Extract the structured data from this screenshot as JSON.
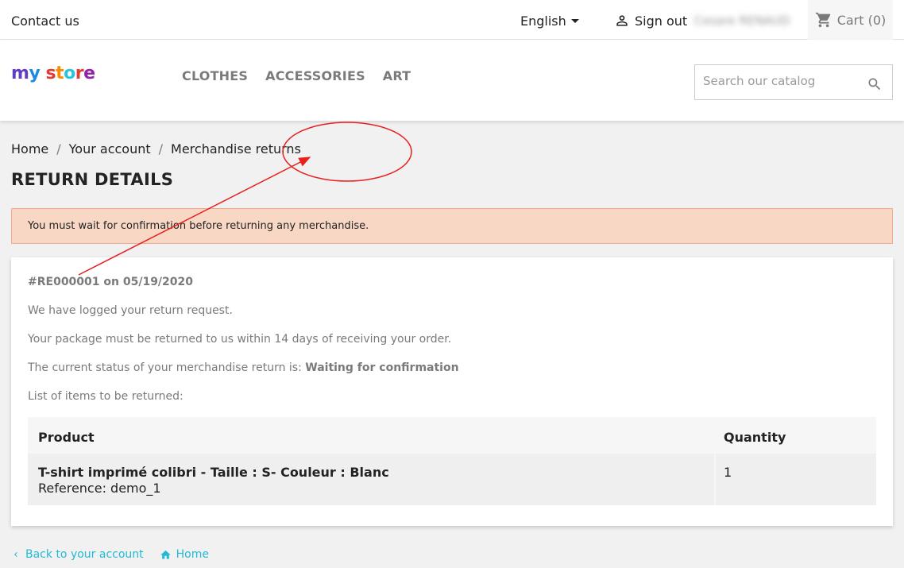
{
  "topbar": {
    "contact": "Contact us",
    "language": "English",
    "signout": "Sign out",
    "username": "Cesare RENAUD",
    "cart": "Cart (0)"
  },
  "header": {
    "logo": {
      "m": "m",
      "y": "y",
      "space": " ",
      "s": "s",
      "t": "t",
      "o": "o",
      "r": "r",
      "e": "e"
    },
    "menu": [
      "CLOTHES",
      "ACCESSORIES",
      "ART"
    ],
    "search_placeholder": "Search our catalog"
  },
  "breadcrumb": [
    "Home",
    "Your account",
    "Merchandise returns"
  ],
  "page_title": "RETURN DETAILS",
  "alert": "You must wait for confirmation before returning any merchandise.",
  "card": {
    "reference": "#RE000001 on 05/19/2020",
    "line1": "We have logged your return request.",
    "line2": "Your package must be returned to us within 14 days of receiving your order.",
    "status_prefix": "The current status of your merchandise return is: ",
    "status": "Waiting for confirmation",
    "line4": "List of items to be returned:",
    "table": {
      "headers": [
        "Product",
        "Quantity"
      ],
      "rows": [
        {
          "product": "T-shirt imprimé colibri - Taille : S- Couleur : Blanc",
          "reference": "Reference: demo_1",
          "quantity": "1"
        }
      ]
    }
  },
  "footer": {
    "back": "Back to your account",
    "home": "Home"
  },
  "colors": {
    "accent": "#24b9d7",
    "alert_bg": "#f8d7c4",
    "alert_border": "#f2a98b",
    "annotation": "#e8201f"
  },
  "icons": [
    "person-icon",
    "cart-icon",
    "search-icon",
    "chevron-left-icon",
    "home-icon",
    "caret-down-icon"
  ]
}
